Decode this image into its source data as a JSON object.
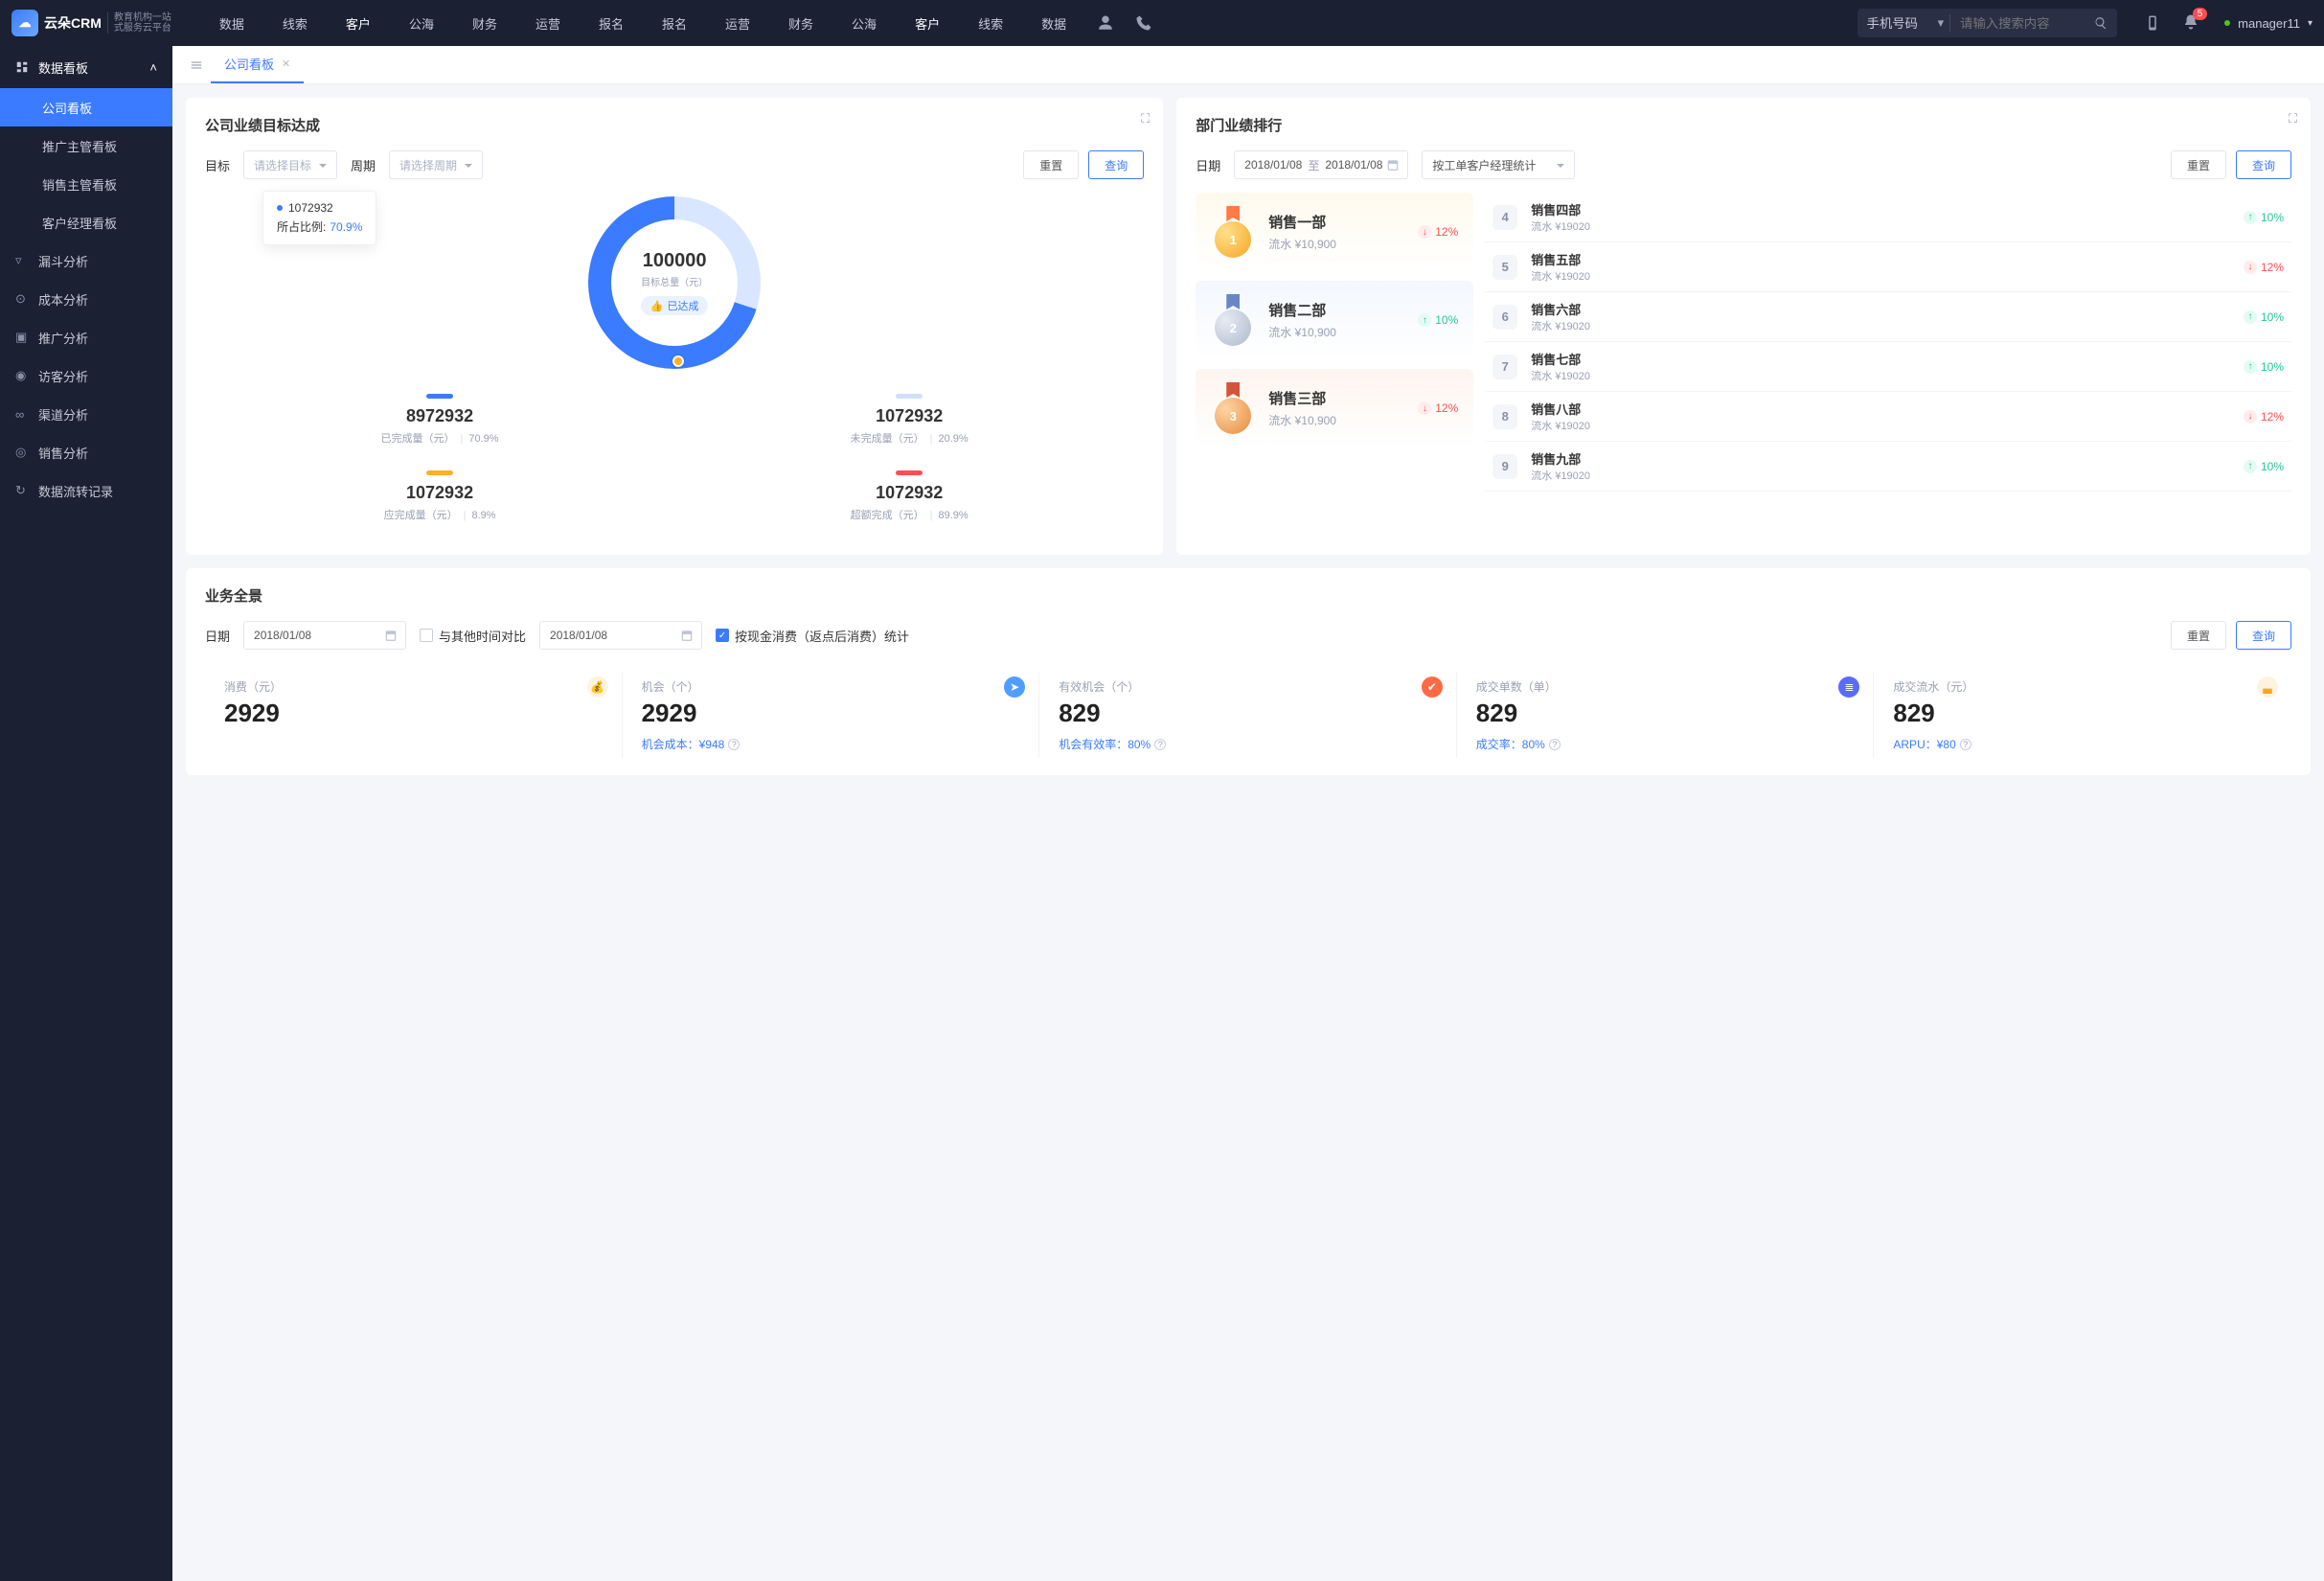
{
  "brand": {
    "name": "云朵CRM",
    "tag1": "教育机构一站",
    "tag2": "式服务云平台"
  },
  "topnav": {
    "items": [
      "数据",
      "线索",
      "客户",
      "公海",
      "财务",
      "运营",
      "报名"
    ],
    "active_index": 2,
    "search_placeholder": "请输入搜索内容",
    "search_type": "手机号码",
    "notif_count": "5",
    "user": "manager11"
  },
  "sidebar": {
    "group_title": "数据看板",
    "children": [
      "公司看板",
      "推广主管看板",
      "销售主管看板",
      "客户经理看板"
    ],
    "active_child": 0,
    "items": [
      "漏斗分析",
      "成本分析",
      "推广分析",
      "访客分析",
      "渠道分析",
      "销售分析",
      "数据流转记录"
    ]
  },
  "tabs": {
    "active": "公司看板"
  },
  "card1": {
    "title": "公司业绩目标达成",
    "goal_label": "目标",
    "goal_placeholder": "请选择目标",
    "period_label": "周期",
    "period_placeholder": "请选择周期",
    "reset": "重置",
    "query": "查询",
    "tooltip": {
      "value": "1072932",
      "ratio_label": "所占比例:",
      "ratio": "70.9%"
    },
    "center_val": "100000",
    "center_label": "目标总量（元）",
    "pill": "已达成",
    "metrics": [
      {
        "color": "#3a7bff",
        "value": "8972932",
        "label": "已完成量（元）",
        "pct": "70.9%"
      },
      {
        "color": "#cfe0ff",
        "value": "1072932",
        "label": "未完成量（元）",
        "pct": "20.9%"
      },
      {
        "color": "#ffb024",
        "value": "1072932",
        "label": "应完成量（元）",
        "pct": "8.9%"
      },
      {
        "color": "#ff4d4f",
        "value": "1072932",
        "label": "超额完成（元）",
        "pct": "89.9%"
      }
    ]
  },
  "card2": {
    "title": "部门业绩排行",
    "date_label": "日期",
    "date_from": "2018/01/08",
    "date_to": "2018/01/08",
    "to": "至",
    "group_by": "按工单客户经理统计",
    "reset": "重置",
    "query": "查询",
    "podium": [
      {
        "rank": "1",
        "name": "销售一部",
        "sub": "流水 ¥10,900",
        "pct": "12%",
        "dir": "down"
      },
      {
        "rank": "2",
        "name": "销售二部",
        "sub": "流水 ¥10,900",
        "pct": "10%",
        "dir": "up"
      },
      {
        "rank": "3",
        "name": "销售三部",
        "sub": "流水 ¥10,900",
        "pct": "12%",
        "dir": "down"
      }
    ],
    "list": [
      {
        "rank": "4",
        "name": "销售四部",
        "sub": "流水 ¥19020",
        "pct": "10%",
        "dir": "up"
      },
      {
        "rank": "5",
        "name": "销售五部",
        "sub": "流水 ¥19020",
        "pct": "12%",
        "dir": "down"
      },
      {
        "rank": "6",
        "name": "销售六部",
        "sub": "流水 ¥19020",
        "pct": "10%",
        "dir": "up"
      },
      {
        "rank": "7",
        "name": "销售七部",
        "sub": "流水 ¥19020",
        "pct": "10%",
        "dir": "up"
      },
      {
        "rank": "8",
        "name": "销售八部",
        "sub": "流水 ¥19020",
        "pct": "12%",
        "dir": "down"
      },
      {
        "rank": "9",
        "name": "销售九部",
        "sub": "流水 ¥19020",
        "pct": "10%",
        "dir": "up"
      }
    ]
  },
  "card3": {
    "title": "业务全景",
    "date_label": "日期",
    "date1": "2018/01/08",
    "compare_label": "与其他时间对比",
    "date2": "2018/01/08",
    "stat_label": "按现金消费（返点后消费）统计",
    "reset": "重置",
    "query": "查询",
    "cells": [
      {
        "label": "消费（元）",
        "value": "2929",
        "foot": "",
        "icon": "#f5a623",
        "iconbg": "#fff3df",
        "glyph": "💰"
      },
      {
        "label": "机会（个）",
        "value": "2929",
        "foot": "机会成本：¥948",
        "icon": "#fff",
        "iconbg": "#4f9dff",
        "glyph": "➤"
      },
      {
        "label": "有效机会（个）",
        "value": "829",
        "foot": "机会有效率：80%",
        "icon": "#fff",
        "iconbg": "#ff6a45",
        "glyph": "✔"
      },
      {
        "label": "成交单数（单）",
        "value": "829",
        "foot": "成交率：80%",
        "icon": "#fff",
        "iconbg": "#5a6bff",
        "glyph": "≣"
      },
      {
        "label": "成交流水（元）",
        "value": "829",
        "foot": "ARPU：¥80",
        "icon": "#f5a623",
        "iconbg": "#fff3df",
        "glyph": "▃"
      }
    ]
  },
  "chart_data": {
    "type": "pie",
    "title": "目标总量（元） 100000",
    "series": [
      {
        "name": "已完成",
        "value": 70.9
      },
      {
        "name": "未完成",
        "value": 29.1
      }
    ],
    "annotations": [
      "已达成"
    ]
  }
}
